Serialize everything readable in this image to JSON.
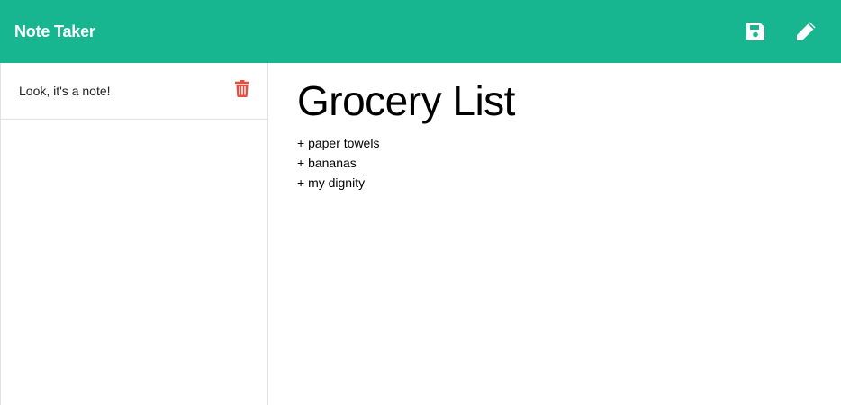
{
  "app": {
    "title": "Note Taker"
  },
  "colors": {
    "accent": "#17b590",
    "icon_white": "#ffffff",
    "delete_red": "#e74c3c",
    "divider": "#dfe3e6"
  },
  "toolbar": {
    "save_icon": "floppy-disk-icon",
    "new_note_icon": "pencil-icon"
  },
  "sidebar": {
    "notes": [
      {
        "title": "Look, it's a note!",
        "delete_icon": "trash-icon"
      }
    ]
  },
  "editor": {
    "title": "Grocery List",
    "lines": [
      "+ paper towels",
      "+ bananas",
      "+ my dignity"
    ]
  }
}
